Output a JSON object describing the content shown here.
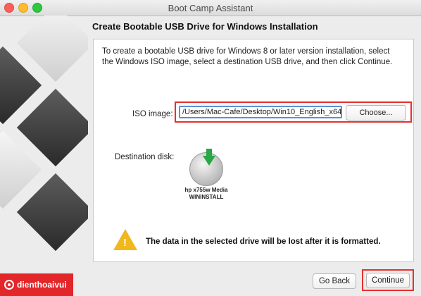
{
  "window": {
    "title": "Boot Camp Assistant"
  },
  "heading": "Create Bootable USB Drive for Windows Installation",
  "description": "To create a bootable USB drive for Windows 8 or later version installation, select the Windows ISO image, select a destination USB drive, and then click Continue.",
  "iso": {
    "label": "ISO image:",
    "value": "/Users/Mac-Cafe/Desktop/Win10_English_x64.",
    "choose_label": "Choose..."
  },
  "destination": {
    "label": "Destination disk:",
    "disk_name_line1": "hp x755w Media",
    "disk_name_line2": "WININSTALL"
  },
  "warning": {
    "text": "The data in the selected drive will be lost after it is formatted."
  },
  "buttons": {
    "go_back": "Go Back",
    "continue": "Continue"
  },
  "brand": {
    "text": "dienthoaivui"
  },
  "colors": {
    "highlight": "#e8302e",
    "warning": "#f1b81d",
    "disk_arrow": "#27a745"
  }
}
